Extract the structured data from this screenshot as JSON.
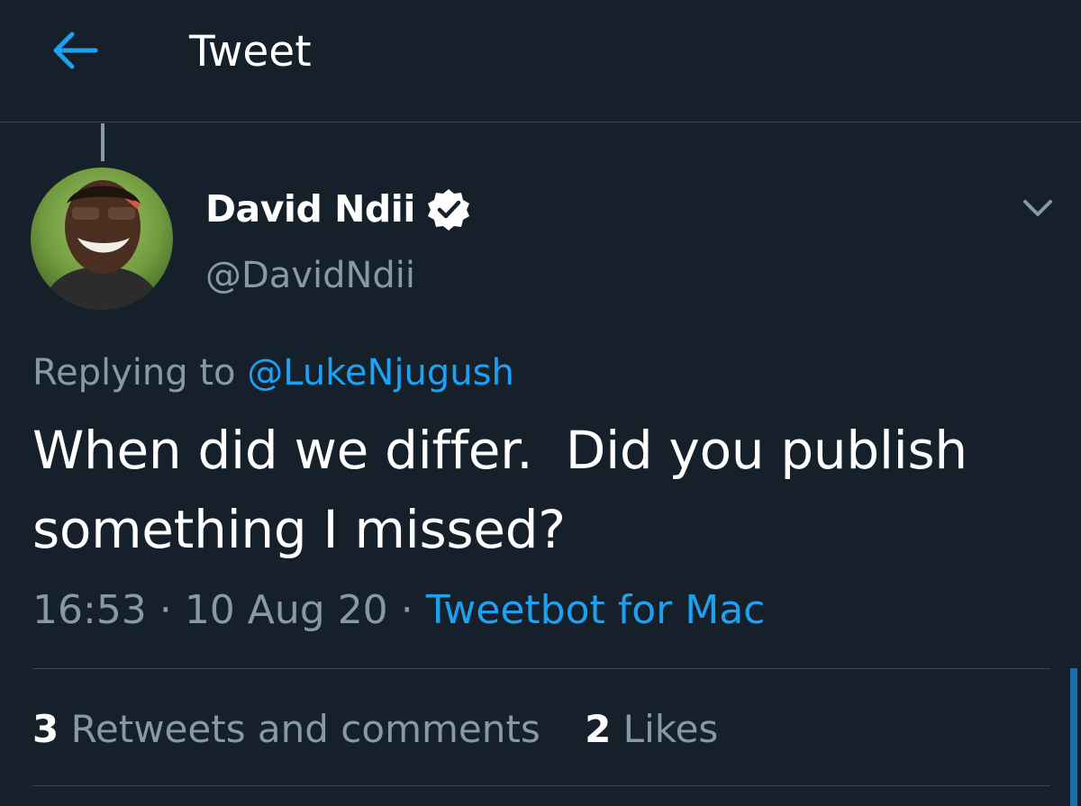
{
  "header": {
    "title": "Tweet",
    "back_icon": "arrow-left-icon"
  },
  "colors": {
    "background": "#15202b",
    "accent": "#1da1f2",
    "muted": "#8899a6",
    "divider": "#38444d"
  },
  "tweet": {
    "author": {
      "name": "David Ndii",
      "handle": "@DavidNdii",
      "verified": true
    },
    "reply": {
      "prefix": "Replying to",
      "handle": "@LukeNjugush"
    },
    "text": "When did we differ.  Did you publish\nsomething I missed?",
    "time": "16:53",
    "date": "10 Aug 20",
    "separator": "·",
    "client": "Tweetbot for Mac"
  },
  "stats": {
    "retweets_count": "3",
    "retweets_label": "Retweets and comments",
    "likes_count": "2",
    "likes_label": "Likes"
  }
}
